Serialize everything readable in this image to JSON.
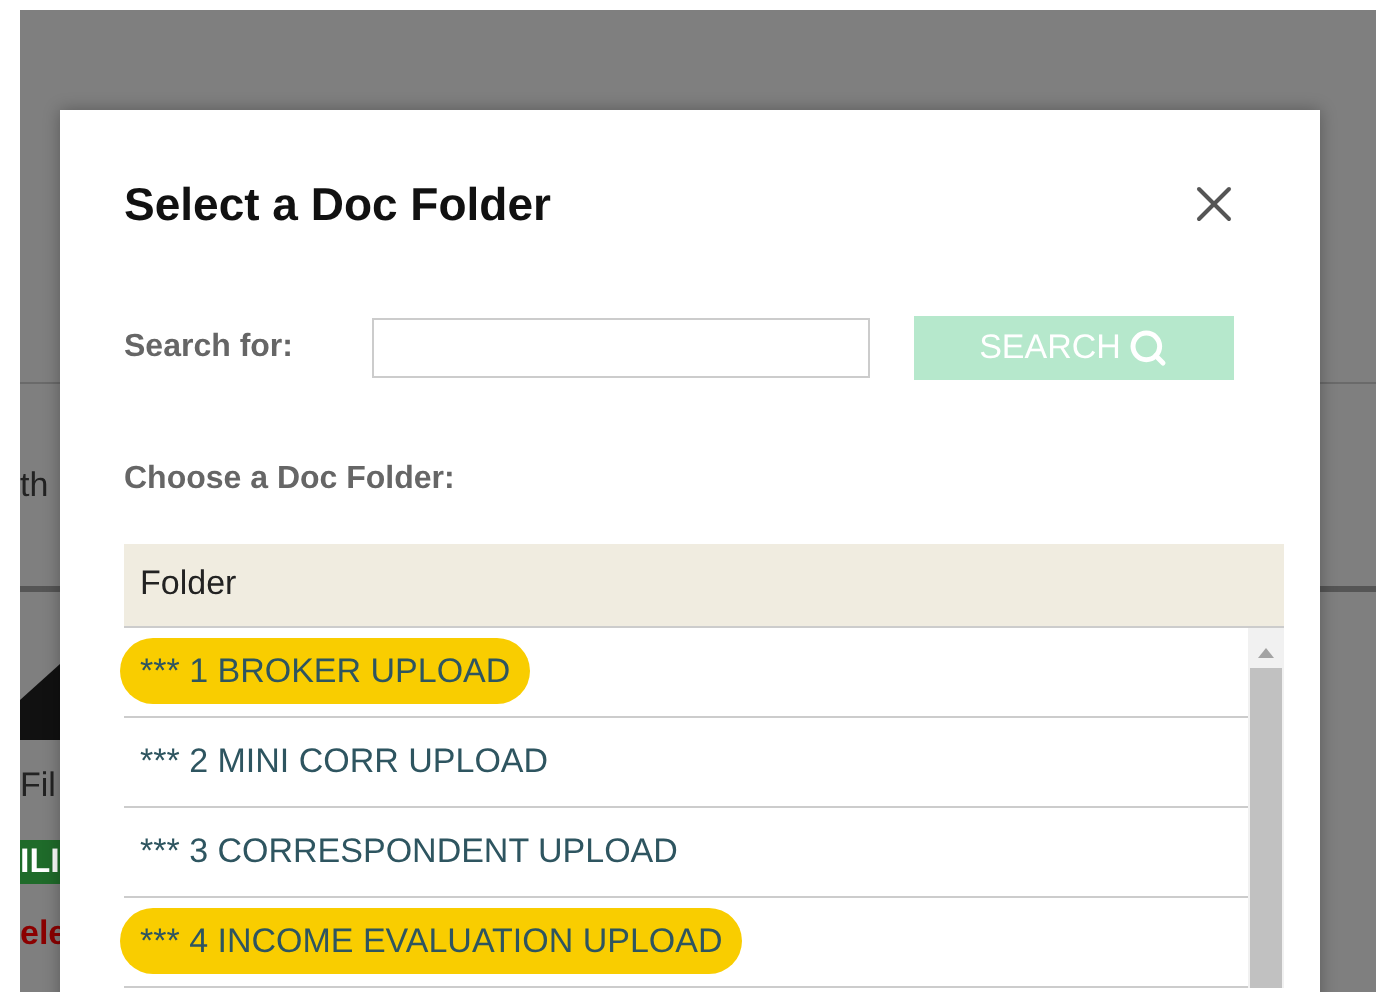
{
  "background": {
    "fragments": [
      {
        "text": "th",
        "kind": "plain"
      },
      {
        "text": "Fil",
        "kind": "plain"
      },
      {
        "text": "ILI",
        "kind": "green"
      },
      {
        "text": "ele",
        "kind": "red"
      }
    ]
  },
  "dialog": {
    "title": "Select a Doc Folder",
    "search_label": "Search for:",
    "search_button": "SEARCH",
    "choose_label": "Choose a Doc Folder:",
    "table": {
      "columns": [
        "Folder"
      ],
      "rows": [
        {
          "folder": "*** 1 BROKER UPLOAD",
          "highlighted": true
        },
        {
          "folder": "*** 2 MINI CORR UPLOAD",
          "highlighted": false
        },
        {
          "folder": "*** 3 CORRESPONDENT UPLOAD",
          "highlighted": false
        },
        {
          "folder": "*** 4 INCOME EVALUATION UPLOAD",
          "highlighted": true
        }
      ]
    }
  }
}
